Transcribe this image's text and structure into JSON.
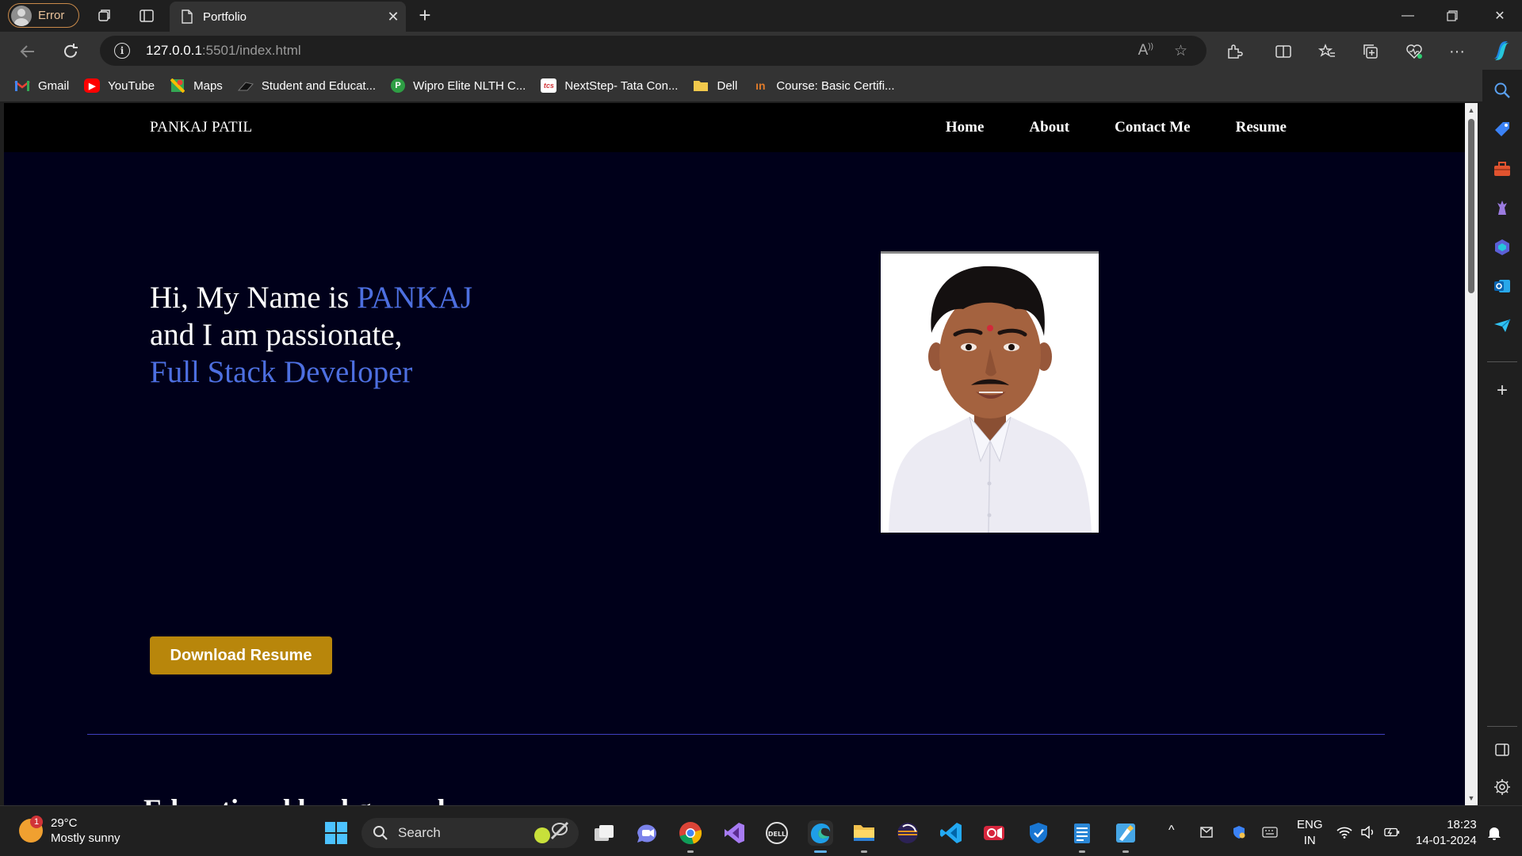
{
  "browser": {
    "profile_label": "Error",
    "tab_title": "Portfolio",
    "url_host": "127.0.0.1",
    "url_rest": ":5501/index.html"
  },
  "bookmarks": [
    {
      "label": "Gmail",
      "icon": "gmail-icon",
      "color": "#ea4335"
    },
    {
      "label": "YouTube",
      "icon": "youtube-icon",
      "color": "#ff0000"
    },
    {
      "label": "Maps",
      "icon": "maps-icon",
      "color": "#34a853"
    },
    {
      "label": "Student and Educat...",
      "icon": "student-icon",
      "color": "#444444"
    },
    {
      "label": "Wipro Elite NLTH C...",
      "icon": "wipro-icon",
      "color": "#2e9e44"
    },
    {
      "label": "NextStep- Tata Con...",
      "icon": "tcs-icon",
      "color": "#d13438"
    },
    {
      "label": "Dell",
      "icon": "folder-icon",
      "color": "#f2c94c"
    },
    {
      "label": "Course: Basic Certifi...",
      "icon": "course-icon",
      "color": "#e07b2a"
    }
  ],
  "site": {
    "brand": "PANKAJ PATIL",
    "nav": [
      "Home",
      "About",
      "Contact Me",
      "Resume"
    ],
    "hero": {
      "line1_prefix": "Hi, My Name is ",
      "line1_name": "PANKAJ",
      "line2": "and I am passionate,",
      "line3": "Full Stack Developer"
    },
    "download_button": "Download Resume",
    "section_title": "Educational background"
  },
  "taskbar": {
    "weather_temp": "29°C",
    "weather_desc": "Mostly sunny",
    "weather_badge": "1",
    "search_label": "Search",
    "lang_line1": "ENG",
    "lang_line2": "IN",
    "time": "18:23",
    "date": "14-01-2024"
  },
  "colors": {
    "page_bg": "#00001a",
    "accent": "#4d6fe0",
    "button": "#b8860b"
  }
}
